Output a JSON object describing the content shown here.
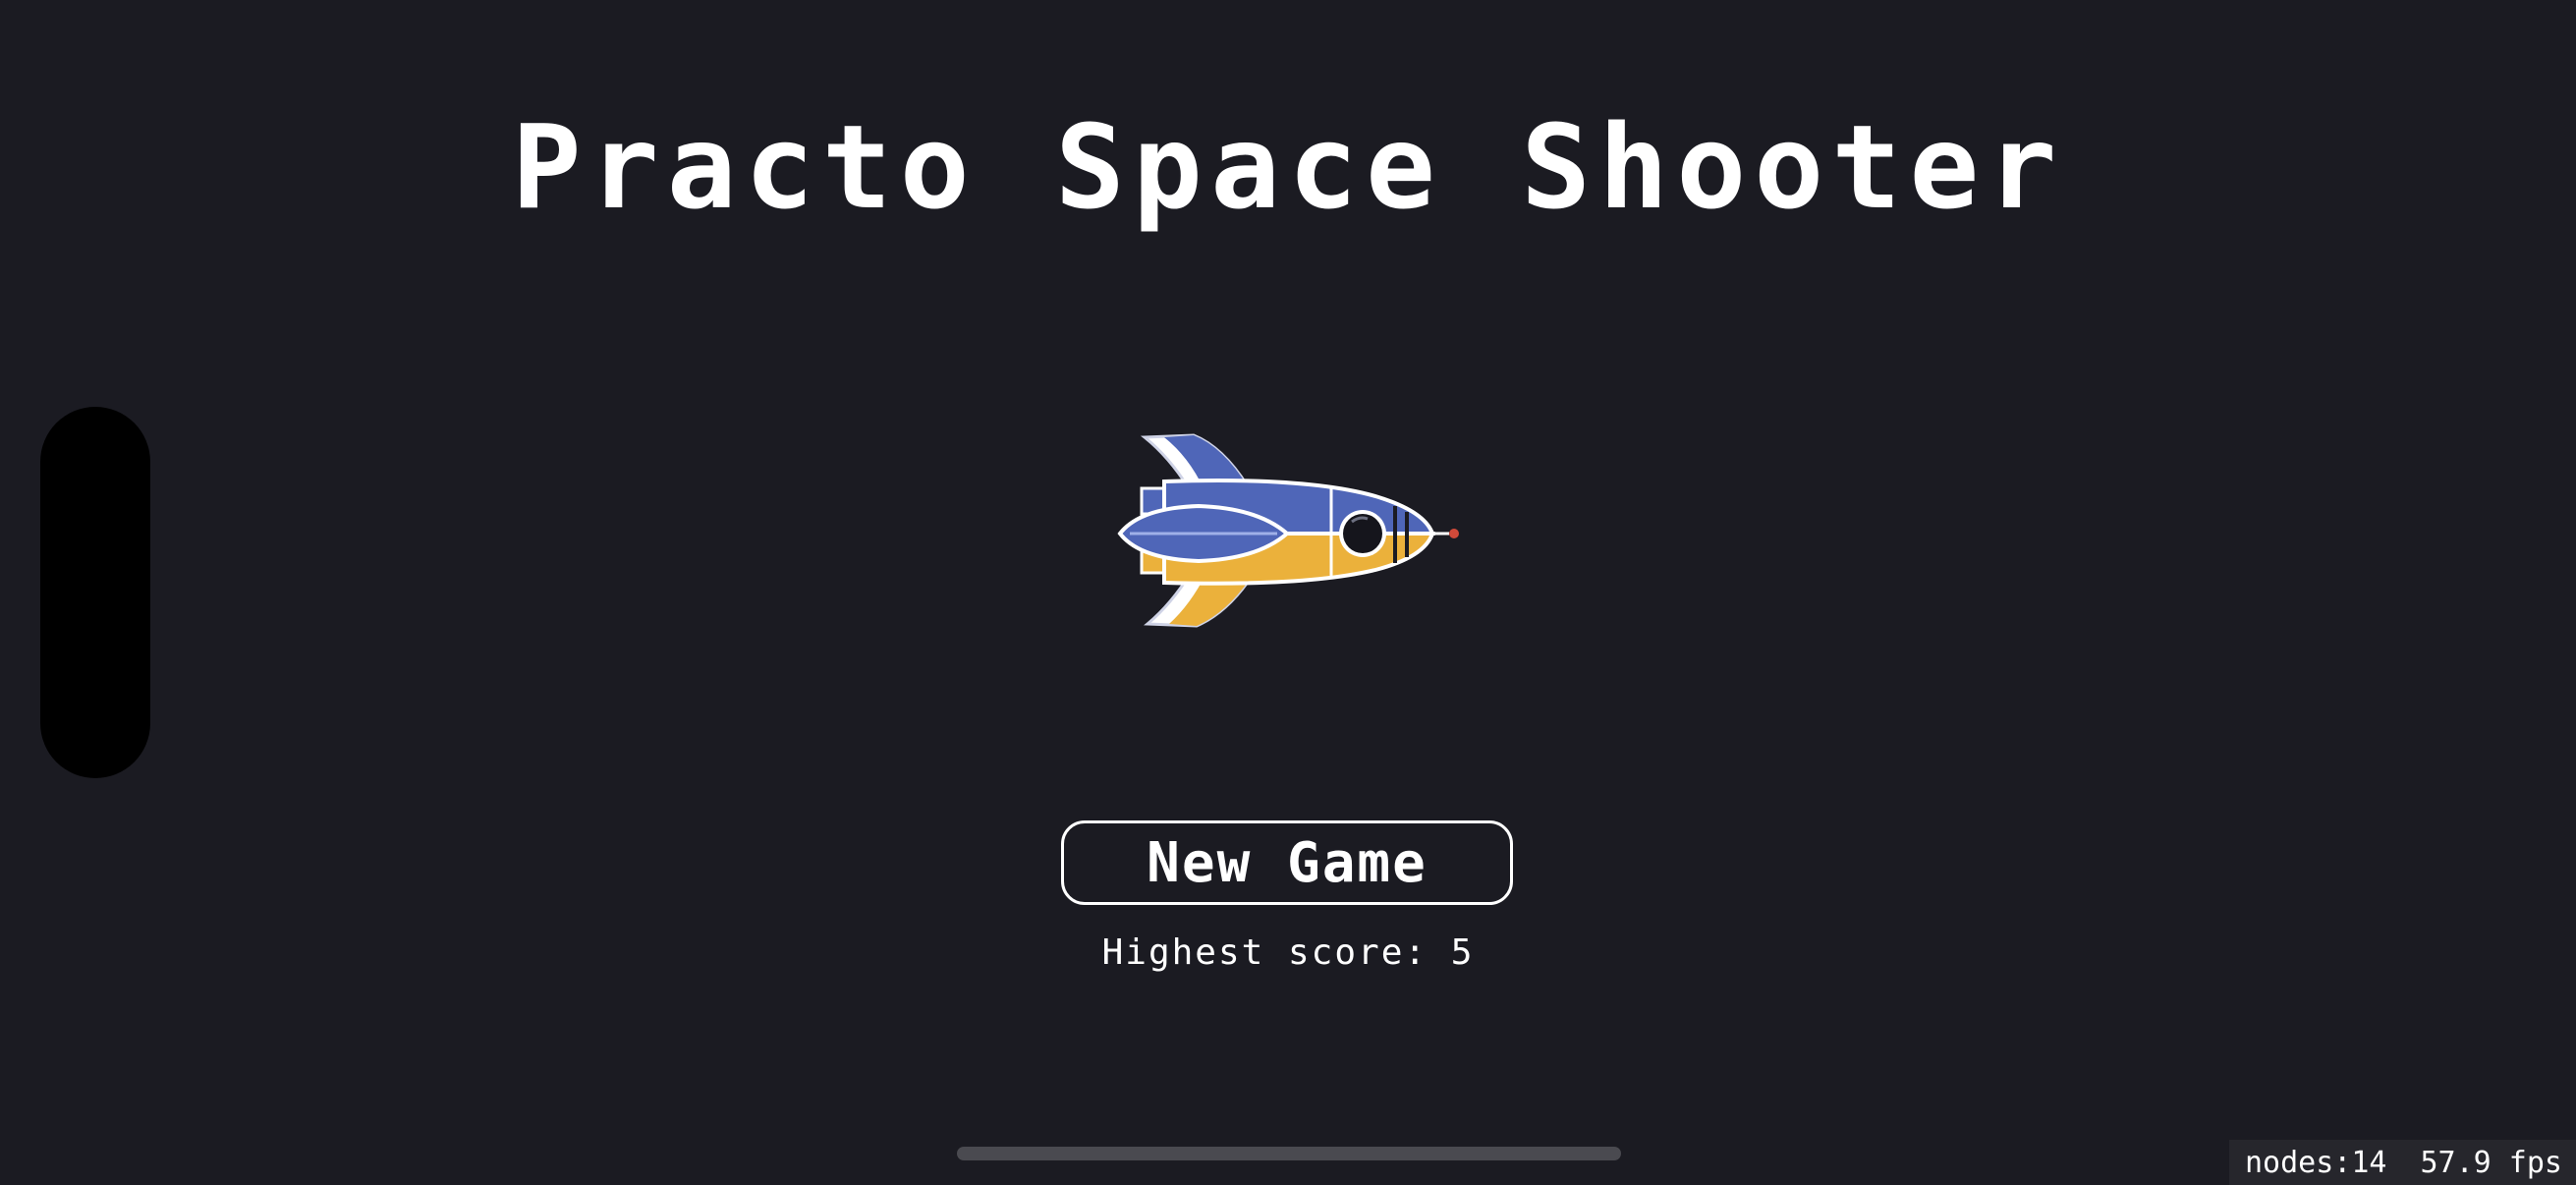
{
  "game": {
    "title": "Practo Space Shooter",
    "new_game_label": "New Game",
    "highest_score_text": "Highest score: 5"
  },
  "debug": {
    "nodes_text": "nodes:14",
    "fps_text": "57.9 fps"
  },
  "colors": {
    "background": "#1b1b22",
    "ship_blue": "#4f66b8",
    "ship_yellow": "#ebb13b",
    "text": "#ffffff"
  }
}
